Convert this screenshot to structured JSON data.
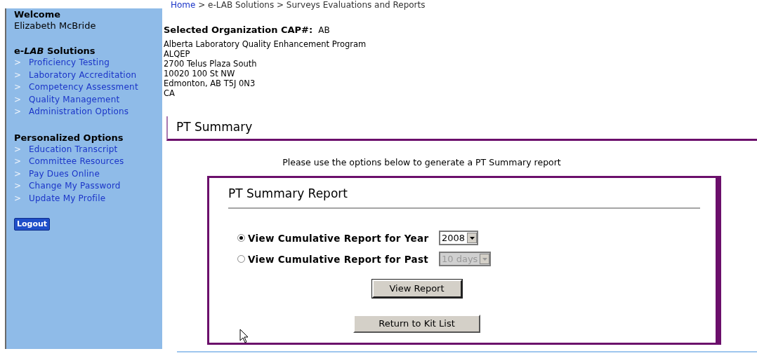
{
  "sidebar": {
    "welcome_label": "Welcome",
    "user_name": "Elizabeth McBride",
    "sections": [
      {
        "title": "e-*LAB* Solutions",
        "items": [
          {
            "marker": ">",
            "label": "Proficiency Testing"
          },
          {
            "marker": ">",
            "label": "Laboratory Accreditation"
          },
          {
            "marker": ">",
            "label": "Competency Assessment"
          },
          {
            "marker": ">",
            "label": "Quality Management"
          },
          {
            "marker": ">",
            "label": "Administration Options"
          }
        ]
      },
      {
        "title": "Personalized Options",
        "items": [
          {
            "marker": ">",
            "label": "Education Transcript"
          },
          {
            "marker": ">",
            "label": "Committee Resources"
          },
          {
            "marker": ">",
            "label": "Pay Dues Online"
          },
          {
            "marker": ">",
            "label": "Change My Password"
          },
          {
            "marker": ">",
            "label": "Update My Profile"
          }
        ]
      }
    ],
    "logout_button": "Logout"
  },
  "breadcrumb": {
    "home": "Home",
    "trail": " > e-LAB Solutions > Surveys Evaluations and Reports"
  },
  "organization": {
    "label": "Selected Organization CAP#:",
    "cap": "AB",
    "address_lines": [
      "Alberta Laboratory Quality Enhancement Program",
      "ALQEP",
      "2700 Telus Plaza South",
      "10020 100 St NW",
      "Edmonton, AB T5J 0N3",
      "CA"
    ]
  },
  "section_title": "PT Summary",
  "instructions": "Please use the options below to generate a PT Summary report",
  "report": {
    "title": "PT Summary Report",
    "options": [
      {
        "label": "View Cumulative Report for Year",
        "selected": true,
        "select_value": "2008",
        "disabled": false
      },
      {
        "label": "View Cumulative Report for Past",
        "selected": false,
        "select_value": "10 days",
        "disabled": true
      }
    ],
    "view_button": "View Report",
    "return_button": "Return to Kit List"
  }
}
